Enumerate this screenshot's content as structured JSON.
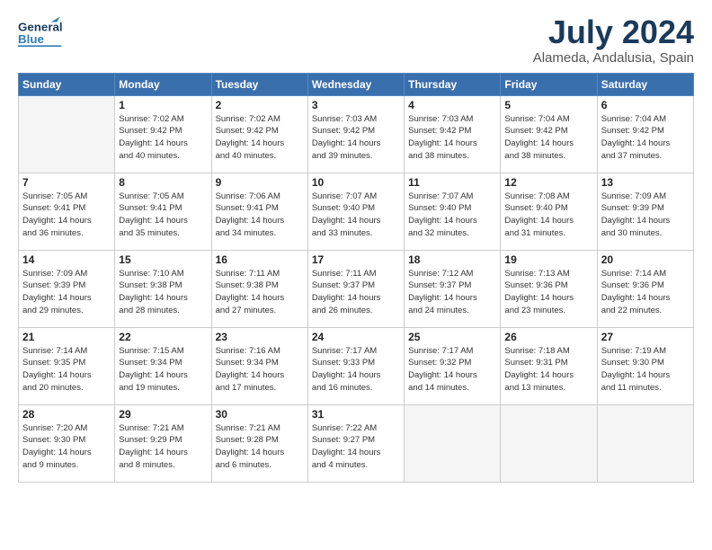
{
  "header": {
    "logo_line1": "General",
    "logo_line2": "Blue",
    "main_title": "July 2024",
    "subtitle": "Alameda, Andalusia, Spain"
  },
  "weekdays": [
    "Sunday",
    "Monday",
    "Tuesday",
    "Wednesday",
    "Thursday",
    "Friday",
    "Saturday"
  ],
  "weeks": [
    [
      {
        "day": "",
        "info": ""
      },
      {
        "day": "1",
        "info": "Sunrise: 7:02 AM\nSunset: 9:42 PM\nDaylight: 14 hours\nand 40 minutes."
      },
      {
        "day": "2",
        "info": "Sunrise: 7:02 AM\nSunset: 9:42 PM\nDaylight: 14 hours\nand 40 minutes."
      },
      {
        "day": "3",
        "info": "Sunrise: 7:03 AM\nSunset: 9:42 PM\nDaylight: 14 hours\nand 39 minutes."
      },
      {
        "day": "4",
        "info": "Sunrise: 7:03 AM\nSunset: 9:42 PM\nDaylight: 14 hours\nand 38 minutes."
      },
      {
        "day": "5",
        "info": "Sunrise: 7:04 AM\nSunset: 9:42 PM\nDaylight: 14 hours\nand 38 minutes."
      },
      {
        "day": "6",
        "info": "Sunrise: 7:04 AM\nSunset: 9:42 PM\nDaylight: 14 hours\nand 37 minutes."
      }
    ],
    [
      {
        "day": "7",
        "info": "Sunrise: 7:05 AM\nSunset: 9:41 PM\nDaylight: 14 hours\nand 36 minutes."
      },
      {
        "day": "8",
        "info": "Sunrise: 7:05 AM\nSunset: 9:41 PM\nDaylight: 14 hours\nand 35 minutes."
      },
      {
        "day": "9",
        "info": "Sunrise: 7:06 AM\nSunset: 9:41 PM\nDaylight: 14 hours\nand 34 minutes."
      },
      {
        "day": "10",
        "info": "Sunrise: 7:07 AM\nSunset: 9:40 PM\nDaylight: 14 hours\nand 33 minutes."
      },
      {
        "day": "11",
        "info": "Sunrise: 7:07 AM\nSunset: 9:40 PM\nDaylight: 14 hours\nand 32 minutes."
      },
      {
        "day": "12",
        "info": "Sunrise: 7:08 AM\nSunset: 9:40 PM\nDaylight: 14 hours\nand 31 minutes."
      },
      {
        "day": "13",
        "info": "Sunrise: 7:09 AM\nSunset: 9:39 PM\nDaylight: 14 hours\nand 30 minutes."
      }
    ],
    [
      {
        "day": "14",
        "info": "Sunrise: 7:09 AM\nSunset: 9:39 PM\nDaylight: 14 hours\nand 29 minutes."
      },
      {
        "day": "15",
        "info": "Sunrise: 7:10 AM\nSunset: 9:38 PM\nDaylight: 14 hours\nand 28 minutes."
      },
      {
        "day": "16",
        "info": "Sunrise: 7:11 AM\nSunset: 9:38 PM\nDaylight: 14 hours\nand 27 minutes."
      },
      {
        "day": "17",
        "info": "Sunrise: 7:11 AM\nSunset: 9:37 PM\nDaylight: 14 hours\nand 26 minutes."
      },
      {
        "day": "18",
        "info": "Sunrise: 7:12 AM\nSunset: 9:37 PM\nDaylight: 14 hours\nand 24 minutes."
      },
      {
        "day": "19",
        "info": "Sunrise: 7:13 AM\nSunset: 9:36 PM\nDaylight: 14 hours\nand 23 minutes."
      },
      {
        "day": "20",
        "info": "Sunrise: 7:14 AM\nSunset: 9:36 PM\nDaylight: 14 hours\nand 22 minutes."
      }
    ],
    [
      {
        "day": "21",
        "info": "Sunrise: 7:14 AM\nSunset: 9:35 PM\nDaylight: 14 hours\nand 20 minutes."
      },
      {
        "day": "22",
        "info": "Sunrise: 7:15 AM\nSunset: 9:34 PM\nDaylight: 14 hours\nand 19 minutes."
      },
      {
        "day": "23",
        "info": "Sunrise: 7:16 AM\nSunset: 9:34 PM\nDaylight: 14 hours\nand 17 minutes."
      },
      {
        "day": "24",
        "info": "Sunrise: 7:17 AM\nSunset: 9:33 PM\nDaylight: 14 hours\nand 16 minutes."
      },
      {
        "day": "25",
        "info": "Sunrise: 7:17 AM\nSunset: 9:32 PM\nDaylight: 14 hours\nand 14 minutes."
      },
      {
        "day": "26",
        "info": "Sunrise: 7:18 AM\nSunset: 9:31 PM\nDaylight: 14 hours\nand 13 minutes."
      },
      {
        "day": "27",
        "info": "Sunrise: 7:19 AM\nSunset: 9:30 PM\nDaylight: 14 hours\nand 11 minutes."
      }
    ],
    [
      {
        "day": "28",
        "info": "Sunrise: 7:20 AM\nSunset: 9:30 PM\nDaylight: 14 hours\nand 9 minutes."
      },
      {
        "day": "29",
        "info": "Sunrise: 7:21 AM\nSunset: 9:29 PM\nDaylight: 14 hours\nand 8 minutes."
      },
      {
        "day": "30",
        "info": "Sunrise: 7:21 AM\nSunset: 9:28 PM\nDaylight: 14 hours\nand 6 minutes."
      },
      {
        "day": "31",
        "info": "Sunrise: 7:22 AM\nSunset: 9:27 PM\nDaylight: 14 hours\nand 4 minutes."
      },
      {
        "day": "",
        "info": ""
      },
      {
        "day": "",
        "info": ""
      },
      {
        "day": "",
        "info": ""
      }
    ]
  ]
}
